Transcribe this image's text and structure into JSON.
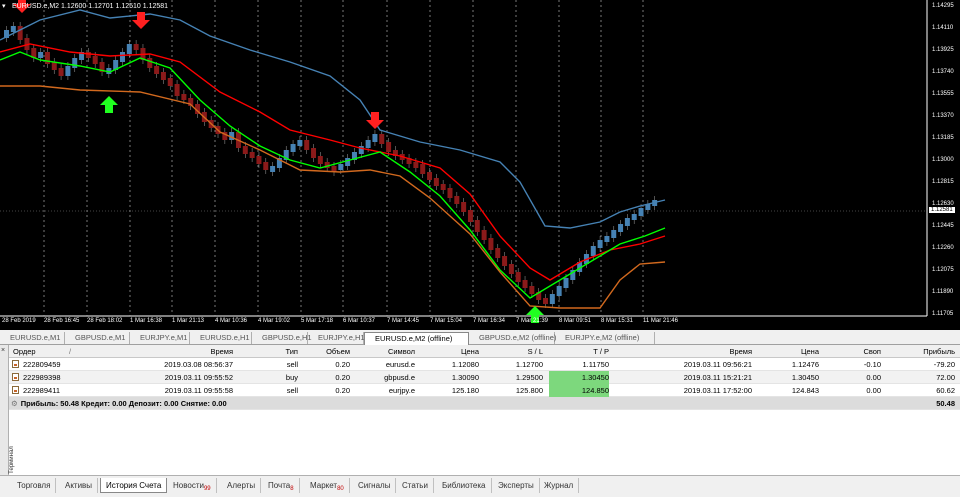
{
  "chart": {
    "symbol_info": "EURUSD.e,M2  1.12600 1.12701 1.12510 1.12581",
    "price_axis": [
      "1.14295",
      "1.14110",
      "1.13925",
      "1.13740",
      "1.13555",
      "1.13370",
      "1.13185",
      "1.13000",
      "1.12815",
      "1.12630",
      "1.12445",
      "1.12260",
      "1.12075",
      "1.11890",
      "1.11705"
    ],
    "current_price": "1.12581",
    "time_axis": [
      "28 Feb 2019",
      "28 Feb 16:45",
      "28 Feb 18:02",
      "1 Mar 16:38",
      "1 Mar 21:13",
      "4 Mar 10:36",
      "4 Mar 19:02",
      "5 Mar 17:18",
      "6 Mar 10:37",
      "7 Mar 14:45",
      "7 Mar 15:04",
      "7 Mar 16:34",
      "7 Mar 21:39",
      "8 Mar 09:51",
      "8 Mar 15:31",
      "11 Mar 21:46"
    ]
  },
  "chart_tabs": [
    {
      "label": "EURUSD.e,M1",
      "active": false
    },
    {
      "label": "GBPUSD.e,M1",
      "active": false
    },
    {
      "label": "EURJPY.e,M1",
      "active": false
    },
    {
      "label": "EURUSD.e,H1",
      "active": false
    },
    {
      "label": "GBPUSD.e,H1",
      "active": false
    },
    {
      "label": "EURJPY.e,H1",
      "active": false
    },
    {
      "label": "EURUSD.e,M2 (offline)",
      "active": true
    },
    {
      "label": "GBPUSD.e,M2 (offline)",
      "active": false
    },
    {
      "label": "EURJPY.e,M2 (offline)",
      "active": false
    }
  ],
  "terminal": {
    "side_label": "Терминал",
    "headers": {
      "order": "Ордер",
      "sort": "/",
      "open_time": "Время",
      "type": "Тип",
      "volume": "Объем",
      "symbol": "Символ",
      "open_price": "Цена",
      "sl": "S / L",
      "tp": "T / P",
      "close_time": "Время",
      "close_price": "Цена",
      "swap": "Своп",
      "profit": "Прибыль"
    },
    "rows": [
      {
        "order": "222809459",
        "open_time": "2019.03.08 08:56:37",
        "type": "sell",
        "volume": "0.20",
        "symbol": "eurusd.e",
        "open_price": "1.12080",
        "sl": "1.12700",
        "tp": "1.11750",
        "close_time": "2019.03.11 09:56:21",
        "close_price": "1.12476",
        "swap": "-0.10",
        "profit": "-79.20"
      },
      {
        "order": "222989398",
        "open_time": "2019.03.11 09:55:52",
        "type": "buy",
        "volume": "0.20",
        "symbol": "gbpusd.e",
        "open_price": "1.30090",
        "sl": "1.29500",
        "tp": "1.30450",
        "close_time": "2019.03.11 15:21:21",
        "close_price": "1.30450",
        "swap": "0.00",
        "profit": "72.00"
      },
      {
        "order": "222989411",
        "open_time": "2019.03.11 09:55:58",
        "type": "sell",
        "volume": "0.20",
        "symbol": "eurjpy.e",
        "open_price": "125.180",
        "sl": "125.800",
        "tp": "124.850",
        "close_time": "2019.03.11 17:52:00",
        "close_price": "124.843",
        "swap": "0.00",
        "profit": "60.62"
      }
    ],
    "summary": "Прибыль: 50.48  Кредит: 0.00  Депозит: 0.00  Снятие: 0.00",
    "summary_total": "50.48"
  },
  "bottom_tabs": [
    {
      "label": "Торговля",
      "badge": ""
    },
    {
      "label": "Активы",
      "badge": ""
    },
    {
      "label": "История Счета",
      "badge": "",
      "active": true
    },
    {
      "label": "Новости",
      "badge": "99"
    },
    {
      "label": "Алерты",
      "badge": ""
    },
    {
      "label": "Почта",
      "badge": "8"
    },
    {
      "label": "Маркет",
      "badge": "80"
    },
    {
      "label": "Сигналы",
      "badge": ""
    },
    {
      "label": "Статьи",
      "badge": ""
    },
    {
      "label": "Библиотека",
      "badge": ""
    },
    {
      "label": "Эксперты",
      "badge": ""
    },
    {
      "label": "Журнал",
      "badge": ""
    }
  ],
  "colors": {
    "bull_candle": "#4682b4",
    "bear_candle": "#8b1a1a",
    "green_line": "#00ff00",
    "red_line": "#ff0000",
    "orange_line": "#d2691e",
    "blue_line": "#4682b4",
    "tp_highlight": "#7dd87d"
  }
}
